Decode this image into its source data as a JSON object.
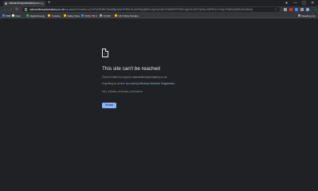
{
  "tab": {
    "title": "cakeandbespokebakery.co.uk",
    "close": "✕"
  },
  "new_tab": "+",
  "window_controls": {
    "profile": "●",
    "minimize": "—",
    "maximize": "▢",
    "close": "✕"
  },
  "toolbar": {
    "back": "←",
    "forward": "→",
    "reload": "↻",
    "url_host": "cakeandbespokebakery.co.uk",
    "url_rest": "/wp-admin/?Inactive-ACAP4KWhf5CMk4jf8gHy9nHP5Rz7KzAHS5pQ8ZKv4gTqUXqPvS3bA5hTR26N7qQrGLSzR7QHbnJ3dPB-Kx7Vz0pTNtWcZ2jf9KdK3uBmQ",
    "star": "☆",
    "menu": "⋮"
  },
  "bookmarks": {
    "items": [
      {
        "label": "BSB",
        "color": "#4285f4"
      },
      {
        "label": "Nest",
        "color": "#e8eaed"
      },
      {
        "label": "Digital Energy",
        "color": "#34a853"
      },
      {
        "label": "Youtube",
        "color": "#fbbc04"
      },
      {
        "label": "Valley Sites",
        "color": "#fbbc04"
      },
      {
        "label": "DFSL TM 2",
        "color": "#4285f4"
      },
      {
        "label": "VC163",
        "color": "#9aa0a6"
      },
      {
        "label": "UK Online Tenders",
        "color": "#fbbc04"
      }
    ],
    "reading_list": "Reading List"
  },
  "error": {
    "icon_face": ":(",
    "title": "This site can’t be reached",
    "line1": "Check if there is a typo in cakeandbespokebakery.co.uk.",
    "line2_prefix": "If spelling is correct, ",
    "line2_link": "try running Windows Network Diagnostics",
    "line2_suffix": ".",
    "code": "DNS_PROBE_FINISHED_NXDOMAIN",
    "reload": "Reload"
  }
}
